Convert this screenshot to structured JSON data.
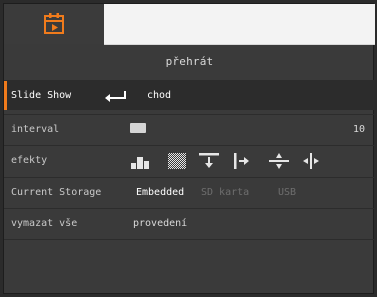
{
  "header": {
    "active_tab_icon": "playback-calendar-icon",
    "accent_color": "#f07b1c"
  },
  "title": "přehrát",
  "rows": {
    "slideshow": {
      "label": "Slide Show",
      "value": "chod",
      "icon": "enter-icon"
    },
    "interval": {
      "label": "interval",
      "value": "10"
    },
    "effects": {
      "label": "efekty",
      "icons": [
        "bars-effect-icon",
        "checker-effect-icon",
        "push-down-effect-icon",
        "push-right-effect-icon",
        "split-vertical-effect-icon",
        "split-horizontal-effect-icon"
      ]
    },
    "storage": {
      "label": "Current Storage",
      "options": [
        "Embedded",
        "SD karta",
        "USB"
      ],
      "selected": "Embedded"
    },
    "delete_all": {
      "label": "vymazat vše",
      "value": "provedení"
    }
  }
}
